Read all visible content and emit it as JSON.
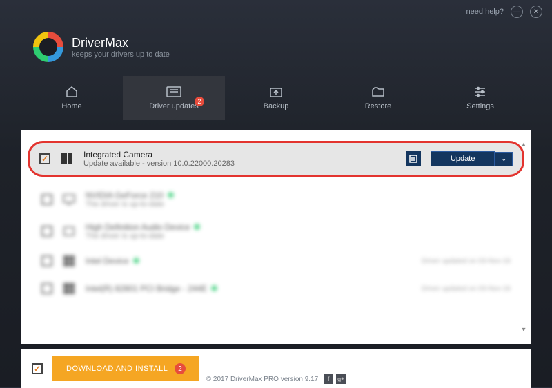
{
  "topbar": {
    "help": "need help?"
  },
  "brand": {
    "title": "DriverMax",
    "tagline": "keeps your drivers up to date"
  },
  "nav": {
    "items": [
      {
        "label": "Home"
      },
      {
        "label": "Driver updates",
        "badge": "2"
      },
      {
        "label": "Backup"
      },
      {
        "label": "Restore"
      },
      {
        "label": "Settings"
      }
    ]
  },
  "highlighted": {
    "name": "Integrated Camera",
    "sub": "Update available - version 10.0.22000.20283",
    "action": "Update"
  },
  "blurred": [
    {
      "name": "NVIDIA GeForce 210",
      "sub": "The driver is up-to-date"
    },
    {
      "name": "High Definition Audio Device",
      "sub": "The driver is up-to-date"
    },
    {
      "name": "Intel Device",
      "sub": "",
      "status": "Driver updated on 03-Nov-16"
    },
    {
      "name": "Intel(R) 82801 PCI Bridge - 244E",
      "sub": "",
      "status": "Driver updated on 03-Nov-16"
    }
  ],
  "footer": {
    "download": "DOWNLOAD AND INSTALL",
    "count": "2"
  },
  "copyright": "© 2017 DriverMax PRO version 9.17"
}
